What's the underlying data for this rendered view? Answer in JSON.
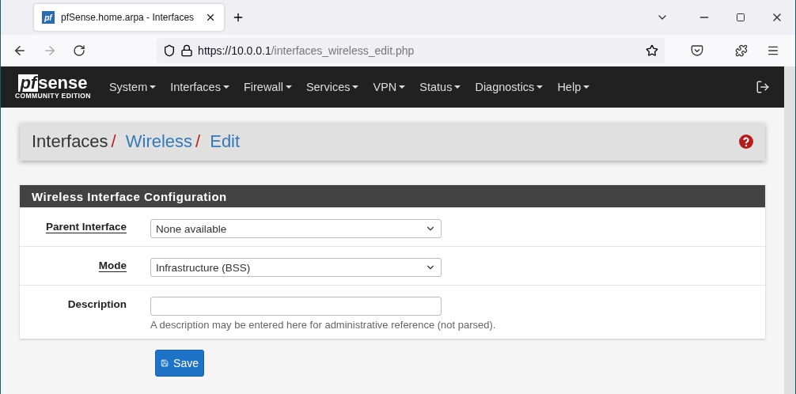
{
  "browser": {
    "tab_title": "pfSense.home.arpa - Interfaces",
    "tab_logo": "pf",
    "url_host": "https://10.0.0.1",
    "url_path": "/interfaces_wireless_edit.php"
  },
  "brand": {
    "pf": "pf",
    "sense": "sense",
    "edition": "COMMUNITY EDITION"
  },
  "nav": [
    {
      "label": "System"
    },
    {
      "label": "Interfaces"
    },
    {
      "label": "Firewall"
    },
    {
      "label": "Services"
    },
    {
      "label": "VPN"
    },
    {
      "label": "Status"
    },
    {
      "label": "Diagnostics"
    },
    {
      "label": "Help"
    }
  ],
  "breadcrumb": [
    {
      "label": "Interfaces",
      "link": false,
      "separator": "/"
    },
    {
      "label": "Wireless",
      "link": true,
      "separator": "/"
    },
    {
      "label": "Edit",
      "link": true
    }
  ],
  "panel": {
    "title": "Wireless Interface Configuration",
    "rows": [
      {
        "kind": "select",
        "label": "Parent Interface",
        "help_link": true,
        "value": "None available"
      },
      {
        "kind": "select",
        "label": "Mode",
        "help_link": true,
        "value": "Infrastructure (BSS)"
      },
      {
        "kind": "text",
        "label": "Description",
        "help_link": false,
        "hint": "A description may be entered here for administrative reference (not parsed)."
      }
    ]
  },
  "save_button": "Save"
}
